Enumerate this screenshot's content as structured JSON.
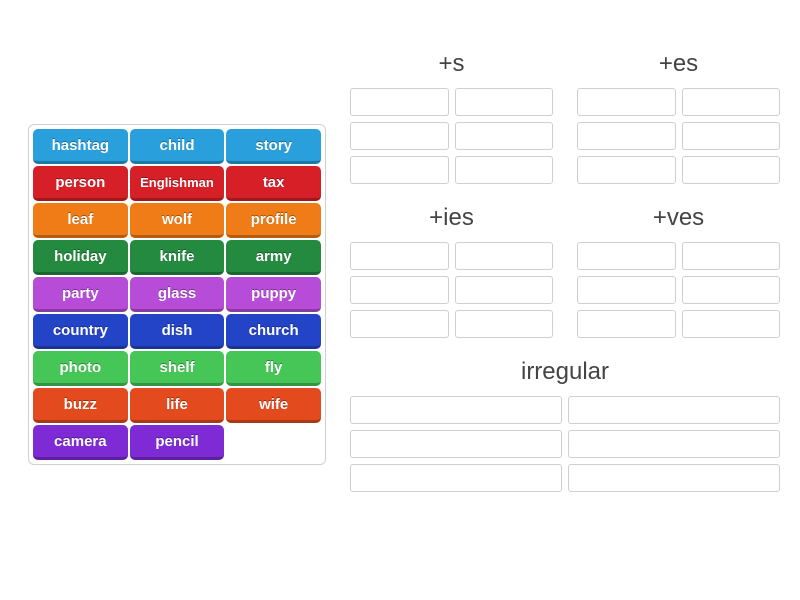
{
  "wordBank": {
    "tiles": [
      {
        "label": "hashtag",
        "colorClass": "c0"
      },
      {
        "label": "child",
        "colorClass": "c0"
      },
      {
        "label": "story",
        "colorClass": "c0"
      },
      {
        "label": "person",
        "colorClass": "c1"
      },
      {
        "label": "Englishman",
        "colorClass": "c1",
        "small": true
      },
      {
        "label": "tax",
        "colorClass": "c1"
      },
      {
        "label": "leaf",
        "colorClass": "c2"
      },
      {
        "label": "wolf",
        "colorClass": "c2"
      },
      {
        "label": "profile",
        "colorClass": "c2"
      },
      {
        "label": "holiday",
        "colorClass": "c3"
      },
      {
        "label": "knife",
        "colorClass": "c3"
      },
      {
        "label": "army",
        "colorClass": "c3"
      },
      {
        "label": "party",
        "colorClass": "c4"
      },
      {
        "label": "glass",
        "colorClass": "c4"
      },
      {
        "label": "puppy",
        "colorClass": "c4"
      },
      {
        "label": "country",
        "colorClass": "c5"
      },
      {
        "label": "dish",
        "colorClass": "c5"
      },
      {
        "label": "church",
        "colorClass": "c5"
      },
      {
        "label": "photo",
        "colorClass": "c6"
      },
      {
        "label": "shelf",
        "colorClass": "c6"
      },
      {
        "label": "fly",
        "colorClass": "c6"
      },
      {
        "label": "buzz",
        "colorClass": "c7"
      },
      {
        "label": "life",
        "colorClass": "c7"
      },
      {
        "label": "wife",
        "colorClass": "c7"
      },
      {
        "label": "camera",
        "colorClass": "c8"
      },
      {
        "label": "pencil",
        "colorClass": "c8"
      }
    ]
  },
  "groups": {
    "row1": [
      {
        "key": "s",
        "title": "+s",
        "slots": 6
      },
      {
        "key": "es",
        "title": "+es",
        "slots": 6
      }
    ],
    "row2": [
      {
        "key": "ies",
        "title": "+ies",
        "slots": 6
      },
      {
        "key": "ves",
        "title": "+ves",
        "slots": 6
      }
    ],
    "row3": [
      {
        "key": "irregular",
        "title": "irregular",
        "slots": 6,
        "centered": true
      }
    ]
  }
}
